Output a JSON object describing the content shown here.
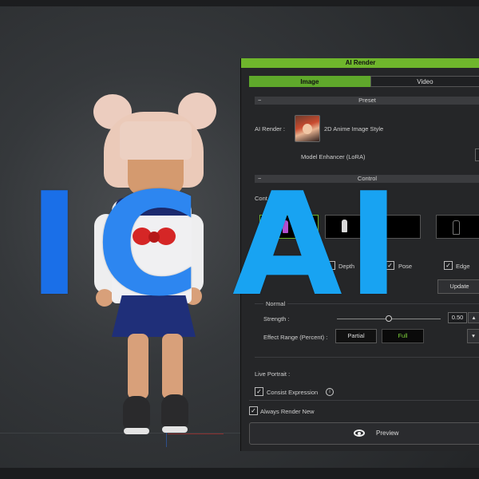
{
  "overlay": {
    "letter_i": "I",
    "letter_c": "C",
    "letter_ai": "AI",
    "colors": {
      "letter_i": "#1a6fe8",
      "letter_c": "#2d86f0",
      "letter_ai": "#18a3f2"
    }
  },
  "panel": {
    "title": "AI Render",
    "tabs": [
      {
        "label": "Image",
        "active": true
      },
      {
        "label": "Video",
        "active": false
      }
    ],
    "preset": {
      "section_label": "Preset",
      "ai_render_label": "AI Render :",
      "style_name": "2D Anime Image Style",
      "model_enhancer_label": "Model Enhancer (LoRA)"
    },
    "control": {
      "section_label": "Control",
      "row_label": "Cont",
      "options": [
        {
          "label": "Depth",
          "checked": false
        },
        {
          "label": "Pose",
          "checked": true
        },
        {
          "label": "Edge",
          "checked": true
        }
      ],
      "update_label": "Update"
    },
    "normal": {
      "group_label": "Normal",
      "strength_label": "Strength :",
      "strength_value": "0.50",
      "strength_fraction": 0.5,
      "effect_range_label": "Effect Range (Percent) :",
      "partial_label": "Partial",
      "full_label": "Full",
      "dropdown_arrow": "▾"
    },
    "live_portrait": {
      "label": "Live Portrait :",
      "consist_expression_label": "Consist Expression",
      "info_glyph": "i",
      "consist_checked": true
    },
    "always_render_new": {
      "label": "Always Render New",
      "checked": true
    },
    "preview_label": "Preview",
    "colors": {
      "accent": "#6fb62c",
      "background": "#252628"
    }
  }
}
